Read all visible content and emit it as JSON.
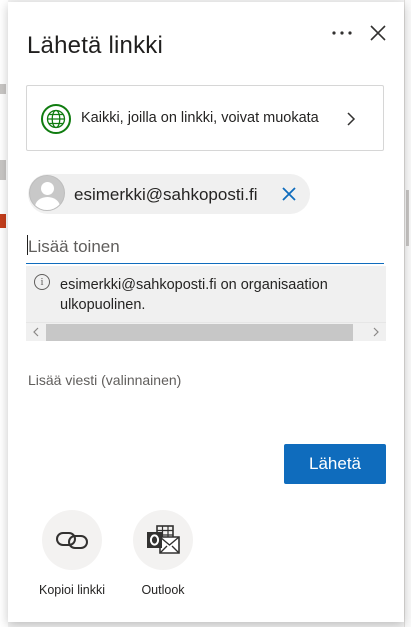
{
  "dialog": {
    "title": "Lähetä linkki",
    "more_icon": "more-horizontal-icon",
    "close_icon": "close-icon"
  },
  "permission": {
    "icon": "globe-icon",
    "label": "Kaikki, joilla on linkki, voivat muokata",
    "chevron_icon": "chevron-right-icon",
    "accent": "#107c10"
  },
  "recipient": {
    "email": "esimerkki@sahkoposti.fi",
    "remove_icon": "remove-x-icon"
  },
  "add_recipient": {
    "placeholder": "Lisää toinen",
    "value": ""
  },
  "notice": {
    "icon": "info-icon",
    "text": "esimerkki@sahkoposti.fi on organisaation ulkopuolinen."
  },
  "message": {
    "placeholder": "Lisää viesti (valinnainen)"
  },
  "send_button": {
    "label": "Lähetä",
    "color": "#0f6cbd"
  },
  "actions": [
    {
      "icon": "link-icon",
      "label": "Kopioi linkki"
    },
    {
      "icon": "outlook-icon",
      "label": "Outlook"
    }
  ]
}
